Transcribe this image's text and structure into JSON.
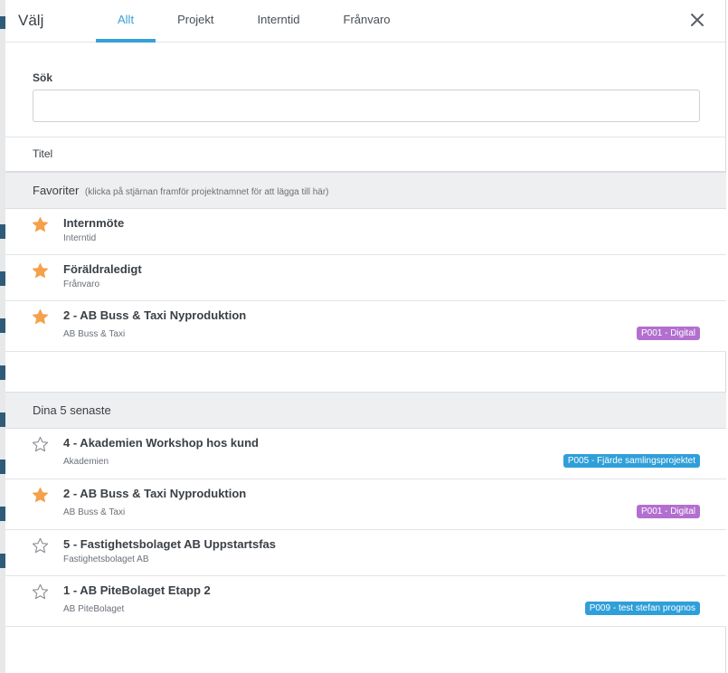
{
  "modal": {
    "title": "Välj",
    "tabs": [
      {
        "label": "Allt",
        "active": true
      },
      {
        "label": "Projekt",
        "active": false
      },
      {
        "label": "Interntid",
        "active": false
      },
      {
        "label": "Frånvaro",
        "active": false
      }
    ],
    "close_icon": "close-icon"
  },
  "search": {
    "label": "Sök",
    "value": "",
    "placeholder": ""
  },
  "list_header": {
    "title_column": "Titel"
  },
  "favorites": {
    "heading": "Favoriter",
    "hint": "(klicka på stjärnan framför projektnamnet för att lägga till här)",
    "items": [
      {
        "name": "Internmöte",
        "sub": "Interntid",
        "starred": true
      },
      {
        "name": "Föräldraledigt",
        "sub": "Frånvaro",
        "starred": true
      },
      {
        "name": "2 - AB Buss & Taxi Nyproduktion",
        "sub": "AB Buss & Taxi",
        "starred": true,
        "tag": "P001 - Digital",
        "tag_color": "#b36fcf"
      }
    ]
  },
  "recent": {
    "heading": "Dina 5 senaste",
    "items": [
      {
        "name": "4 - Akademien Workshop hos kund",
        "sub": "Akademien",
        "starred": false,
        "tag": "P005 - Fjärde samlingsprojektet",
        "tag_color": "#2f9fd9"
      },
      {
        "name": "2 - AB Buss & Taxi Nyproduktion",
        "sub": "AB Buss & Taxi",
        "starred": true,
        "tag": "P001 - Digital",
        "tag_color": "#b36fcf"
      },
      {
        "name": "5 - Fastighetsbolaget AB Uppstartsfas",
        "sub": "Fastighetsbolaget AB",
        "starred": false
      },
      {
        "name": "1 - AB PiteBolaget Etapp 2",
        "sub": "AB PiteBolaget",
        "starred": false,
        "tag": "P009 - test stefan prognos",
        "tag_color": "#2f9fd9"
      }
    ]
  },
  "colors": {
    "accent": "#37a0d8",
    "star_filled": "#f5a04a",
    "star_empty": "#8b9096"
  }
}
